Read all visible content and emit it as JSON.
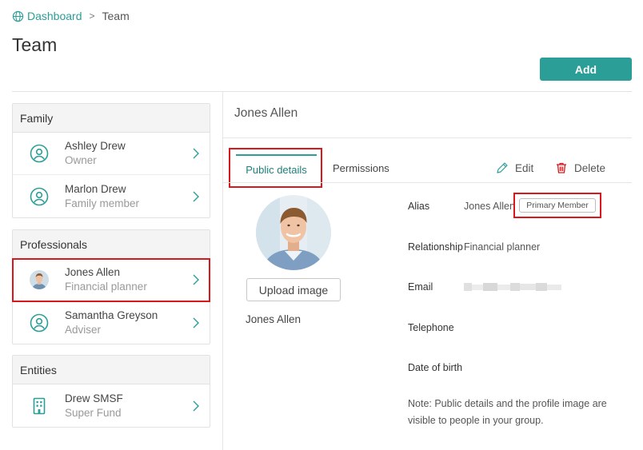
{
  "breadcrumb": {
    "icon": "globe-icon",
    "link": "Dashboard",
    "separator": ">",
    "current": "Team"
  },
  "page_title": "Team",
  "add_button": "Add",
  "colors": {
    "accent": "#2b9e98",
    "highlight": "#d9171d"
  },
  "groups": [
    {
      "title": "Family",
      "members": [
        {
          "name": "Ashley Drew",
          "role": "Owner",
          "icon": "person-circle-icon"
        },
        {
          "name": "Marlon Drew",
          "role": "Family member",
          "icon": "person-circle-icon"
        }
      ]
    },
    {
      "title": "Professionals",
      "members": [
        {
          "name": "Jones Allen",
          "role": "Financial planner",
          "icon": "avatar-photo",
          "selected": true
        },
        {
          "name": "Samantha Greyson",
          "role": "Adviser",
          "icon": "person-circle-icon"
        }
      ]
    },
    {
      "title": "Entities",
      "members": [
        {
          "name": "Drew SMSF",
          "role": "Super Fund",
          "icon": "building-icon"
        }
      ]
    }
  ],
  "detail": {
    "name": "Jones Allen",
    "tabs": [
      "Public details",
      "Permissions"
    ],
    "actions": {
      "edit": "Edit",
      "delete": "Delete"
    },
    "upload_button": "Upload image",
    "photo_caption": "Jones Allen",
    "fields": {
      "alias_label": "Alias",
      "alias_value": "Jones Allen",
      "primary_badge": "Primary Member",
      "relationship_label": "Relationship",
      "relationship_value": "Financial planner",
      "email_label": "Email",
      "telephone_label": "Telephone",
      "dob_label": "Date of birth"
    },
    "note": "Note: Public details and the profile image are visible to people in your group."
  }
}
